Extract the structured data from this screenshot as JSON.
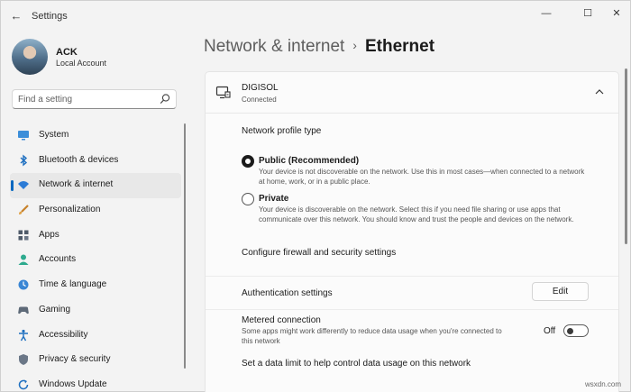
{
  "window": {
    "title": "Settings",
    "back": "←",
    "minimize": "—",
    "maximize": "☐",
    "close": "✕"
  },
  "user": {
    "name": "ACK",
    "account_type": "Local Account"
  },
  "search": {
    "placeholder": "Find a setting"
  },
  "sidebar": {
    "items": [
      {
        "label": "System",
        "icon": "monitor-icon",
        "selected": false
      },
      {
        "label": "Bluetooth & devices",
        "icon": "bluetooth-icon",
        "selected": false
      },
      {
        "label": "Network & internet",
        "icon": "wifi-icon",
        "selected": true
      },
      {
        "label": "Personalization",
        "icon": "brush-icon",
        "selected": false
      },
      {
        "label": "Apps",
        "icon": "apps-icon",
        "selected": false
      },
      {
        "label": "Accounts",
        "icon": "person-icon",
        "selected": false
      },
      {
        "label": "Time & language",
        "icon": "globe-clock-icon",
        "selected": false
      },
      {
        "label": "Gaming",
        "icon": "gamepad-icon",
        "selected": false
      },
      {
        "label": "Accessibility",
        "icon": "accessibility-icon",
        "selected": false
      },
      {
        "label": "Privacy & security",
        "icon": "shield-icon",
        "selected": false
      },
      {
        "label": "Windows Update",
        "icon": "update-icon",
        "selected": false
      }
    ]
  },
  "breadcrumb": {
    "parent": "Network & internet",
    "separator": "›",
    "current": "Ethernet"
  },
  "network": {
    "name": "DIGISOL",
    "status": "Connected"
  },
  "profile": {
    "section_label": "Network profile type",
    "public_title": "Public (Recommended)",
    "public_desc": "Your device is not discoverable on the network. Use this in most cases—when connected to a network at home, work, or in a public place.",
    "private_title": "Private",
    "private_desc": "Your device is discoverable on the network. Select this if you need file sharing or use apps that communicate over this network. You should know and trust the people and devices on the network.",
    "selected": "public"
  },
  "firewall_link": "Configure firewall and security settings",
  "authentication": {
    "label": "Authentication settings",
    "button": "Edit"
  },
  "metered": {
    "label": "Metered connection",
    "description": "Some apps might work differently to reduce data usage when you're connected to this network",
    "state_label": "Off",
    "on": false
  },
  "data_limit_text": "Set a data limit to help control data usage on this network",
  "watermark": "wsxdn.com",
  "colors": {
    "accent": "#0067c0",
    "background": "#f3f3f3",
    "panel": "#fbfbfb"
  }
}
